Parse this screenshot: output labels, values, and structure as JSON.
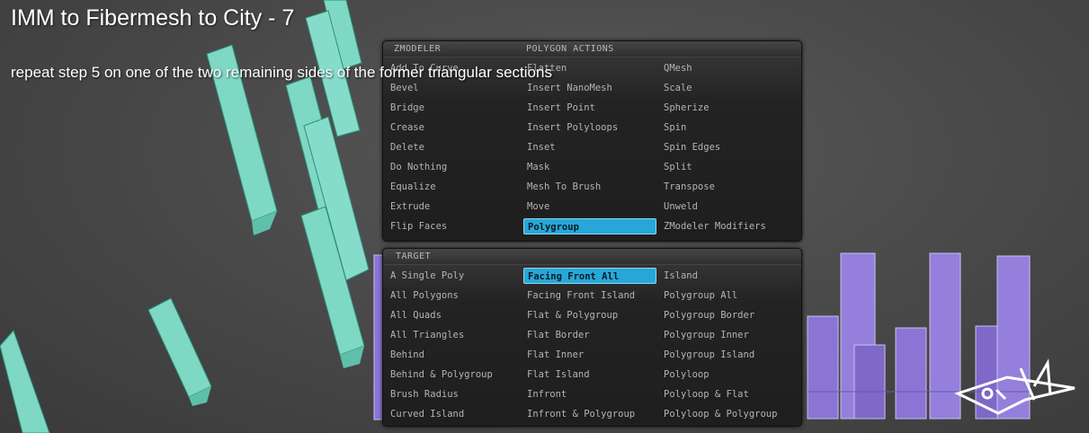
{
  "overlay": {
    "title": "IMM to Fibermesh to City - 7",
    "subtitle": "repeat step 5 on one of the two remaining sides of the former triangular sections"
  },
  "colors": {
    "selection": "#27a7d8",
    "teal_mesh": "#7fd8c4",
    "purple_mesh": "#8a74d4",
    "panel_bg": "#222222"
  },
  "zmodeler_menu": {
    "header_left": "ZMODELER",
    "header_right": "POLYGON ACTIONS",
    "columns": [
      [
        "Add To Curve",
        "Bevel",
        "Bridge",
        "Crease",
        "Delete",
        "Do Nothing",
        "Equalize",
        "Extrude",
        "Flip Faces"
      ],
      [
        "Flatten",
        "Insert NanoMesh",
        "Insert Point",
        "Insert Polyloops",
        "Inset",
        "Mask",
        "Mesh To Brush",
        "Move",
        "Polygroup"
      ],
      [
        "QMesh",
        "Scale",
        "Spherize",
        "Spin",
        "Spin Edges",
        "Split",
        "Transpose",
        "Unweld",
        "ZModeler Modifiers"
      ]
    ],
    "selected": "Polygroup"
  },
  "target_menu": {
    "header": "TARGET",
    "columns": [
      [
        "A Single Poly",
        "All Polygons",
        "All Quads",
        "All Triangles",
        "Behind",
        "Behind & Polygroup",
        "Brush Radius",
        "Curved Island"
      ],
      [
        "Facing Front All",
        "Facing Front Island",
        "Flat & Polygroup",
        "Flat Border",
        "Flat Inner",
        "Flat Island",
        "Infront",
        "Infront & Polygroup"
      ],
      [
        "Island",
        "Polygroup All",
        "Polygroup Border",
        "Polygroup Inner",
        "Polygroup Island",
        "Polyloop",
        "Polyloop & Flat",
        "Polyloop & Polygroup"
      ]
    ],
    "selected": "Facing Front All"
  },
  "logo": {
    "name": "logo-icon"
  }
}
